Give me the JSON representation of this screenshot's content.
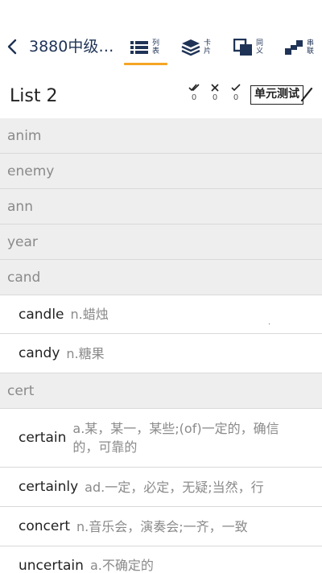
{
  "header": {
    "book_title": "3880中级…",
    "tabs": [
      {
        "icon": "list-icon",
        "l1": "列",
        "l2": "表"
      },
      {
        "icon": "cards-icon",
        "l1": "卡",
        "l2": "片"
      },
      {
        "icon": "synonym-icon",
        "l1": "同",
        "l2": "义"
      },
      {
        "icon": "chain-icon",
        "l1": "串",
        "l2": "联"
      }
    ],
    "active_tab_color": "#f5a623",
    "title_color": "#1f3356"
  },
  "list_header": {
    "title": "List 2",
    "stats": [
      {
        "icon": "double-check-icon",
        "count": "0"
      },
      {
        "icon": "cross-icon",
        "count": "0"
      },
      {
        "icon": "check-icon",
        "count": "0"
      }
    ],
    "unit_test_label": "单元测试"
  },
  "rows": [
    {
      "type": "group",
      "text": "anim"
    },
    {
      "type": "group",
      "text": "enemy"
    },
    {
      "type": "group",
      "text": "ann"
    },
    {
      "type": "group",
      "text": "year"
    },
    {
      "type": "group",
      "text": "cand"
    },
    {
      "type": "word",
      "word": "candle",
      "meaning": "n.蜡烛"
    },
    {
      "type": "word",
      "word": "candy",
      "meaning": "n.糖果"
    },
    {
      "type": "group",
      "text": "cert"
    },
    {
      "type": "word",
      "word": "certain",
      "meaning": "a.某，某一，某些;(of)一定的，确信的，可靠的"
    },
    {
      "type": "word",
      "word": "certainly",
      "meaning": "ad.一定，必定，无疑;当然，行"
    },
    {
      "type": "word",
      "word": "concert",
      "meaning": "n.音乐会，演奏会;一齐，一致"
    },
    {
      "type": "word",
      "word": "uncertain",
      "meaning": "a.不确定的"
    }
  ]
}
